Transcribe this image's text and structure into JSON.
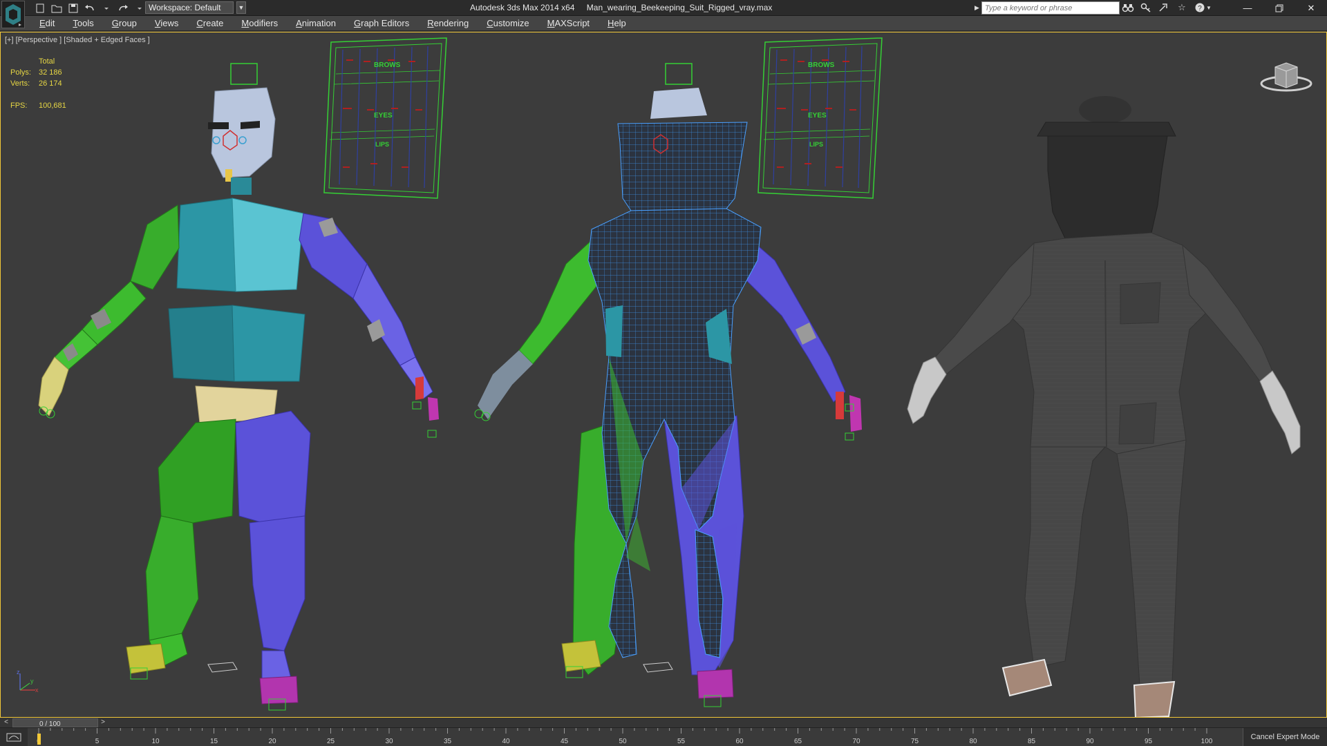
{
  "titlebar": {
    "workspace_label": "Workspace: Default",
    "app_title": "Autodesk 3ds Max  2014 x64",
    "file_name": "Man_wearing_Beekeeping_Suit_Rigged_vray.max",
    "search_placeholder": "Type a keyword or phrase"
  },
  "menu": {
    "items": [
      "Edit",
      "Tools",
      "Group",
      "Views",
      "Create",
      "Modifiers",
      "Animation",
      "Graph Editors",
      "Rendering",
      "Customize",
      "MAXScript",
      "Help"
    ]
  },
  "viewport": {
    "label": "[+] [Perspective ] [Shaded + Edged Faces ]",
    "stats": {
      "header": "Total",
      "polys_label": "Polys:",
      "polys_value": "32 186",
      "verts_label": "Verts:",
      "verts_value": "26 174",
      "fps_label": "FPS:",
      "fps_value": "100,681"
    },
    "panel_labels": {
      "brows": "BROWS",
      "eyes": "EYES",
      "lips": "LIPS"
    },
    "axis": {
      "x": "x",
      "y": "y",
      "z": "z"
    }
  },
  "timeline": {
    "frame_label": "0 / 100",
    "ticks": [
      "0",
      "5",
      "10",
      "15",
      "20",
      "25",
      "30",
      "35",
      "40",
      "45",
      "50",
      "55",
      "60",
      "65",
      "70",
      "75",
      "80",
      "85",
      "90",
      "95",
      "100"
    ],
    "cancel_expert_label": "Cancel Expert Mode"
  },
  "colors": {
    "accent_yellow": "#f2c838",
    "rig_green": "#3fb22a",
    "rig_blue": "#5b52d9",
    "rig_teal": "#2a9aa8",
    "wire_blue": "#4aa0ff",
    "suit_gray": "#454545"
  }
}
